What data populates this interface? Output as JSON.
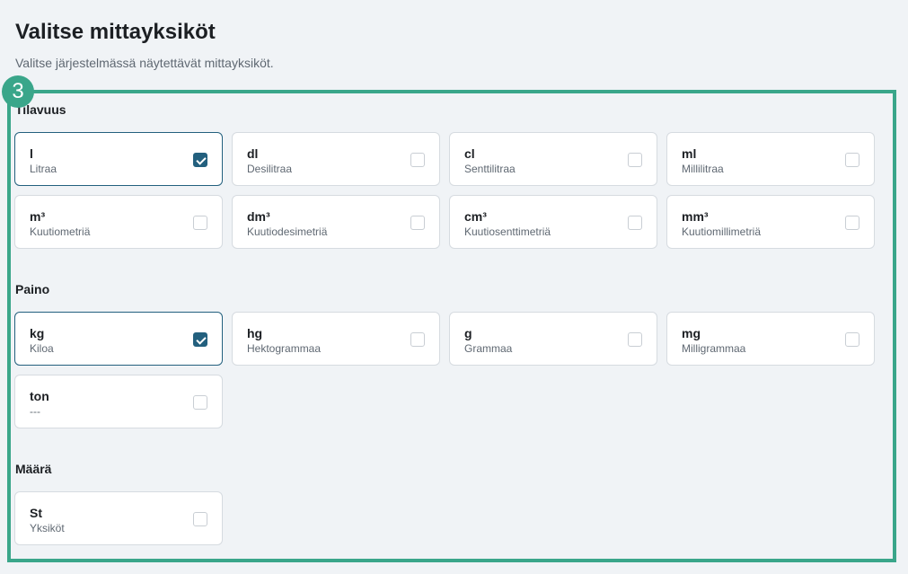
{
  "header": {
    "title": "Valitse mittayksiköt",
    "subtitle": "Valitse järjestelmässä näytettävät mittayksiköt."
  },
  "highlight": {
    "step_number": "3",
    "color": "#3aa68a"
  },
  "accent_color": "#23607e",
  "sections": {
    "volume": {
      "title": "Tilavuus",
      "units": [
        {
          "abbr": "l",
          "name": "Litraa",
          "selected": true
        },
        {
          "abbr": "dl",
          "name": "Desilitraa",
          "selected": false
        },
        {
          "abbr": "cl",
          "name": "Senttilitraa",
          "selected": false
        },
        {
          "abbr": "ml",
          "name": "Millilitraa",
          "selected": false
        },
        {
          "abbr": "m³",
          "name": "Kuutiometriä",
          "selected": false
        },
        {
          "abbr": "dm³",
          "name": "Kuutiodesimetriä",
          "selected": false
        },
        {
          "abbr": "cm³",
          "name": "Kuutiosenttimetriä",
          "selected": false
        },
        {
          "abbr": "mm³",
          "name": "Kuutiomillimetriä",
          "selected": false
        }
      ]
    },
    "weight": {
      "title": "Paino",
      "units": [
        {
          "abbr": "kg",
          "name": "Kiloa",
          "selected": true
        },
        {
          "abbr": "hg",
          "name": "Hektogrammaa",
          "selected": false
        },
        {
          "abbr": "g",
          "name": "Grammaa",
          "selected": false
        },
        {
          "abbr": "mg",
          "name": "Milligrammaa",
          "selected": false
        },
        {
          "abbr": "ton",
          "name": "---",
          "selected": false
        }
      ]
    },
    "quantity": {
      "title": "Määrä",
      "units": [
        {
          "abbr": "St",
          "name": "Yksiköt",
          "selected": false
        }
      ]
    }
  }
}
